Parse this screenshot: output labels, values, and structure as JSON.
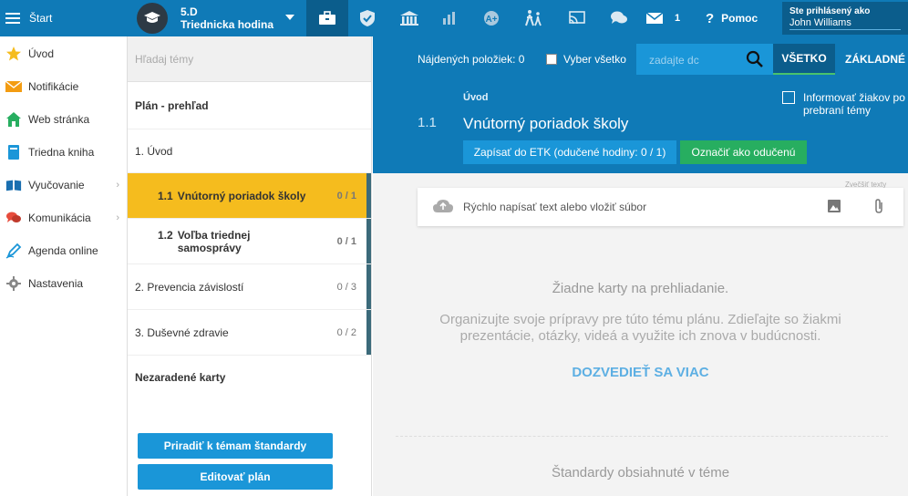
{
  "topbar": {
    "start_label": "Štart",
    "class_name": "5.D",
    "class_subtitle": "Triednicka hodina",
    "mail_count": "1",
    "help_label": "Pomoc",
    "logged_in_label": "Ste prihlásený ako",
    "user_name": "John Williams"
  },
  "sidebar": {
    "items": [
      {
        "label": "Úvod",
        "icon": "star-icon",
        "color": "#f5bc1e"
      },
      {
        "label": "Notifikácie",
        "icon": "envelope-icon",
        "color": "#f39c12"
      },
      {
        "label": "Web stránka",
        "icon": "home-icon",
        "color": "#27ae60"
      },
      {
        "label": "Triedna kniha",
        "icon": "book-icon",
        "color": "#1a96d8"
      },
      {
        "label": "Vyučovanie",
        "icon": "open-book-icon",
        "color": "#1a6fb0"
      },
      {
        "label": "Komunikácia",
        "icon": "chat-icon",
        "color": "#e74c3c"
      },
      {
        "label": "Agenda online",
        "icon": "pen-icon",
        "color": "#1a96d8"
      },
      {
        "label": "Nastavenia",
        "icon": "gear-icon",
        "color": "#888888"
      }
    ]
  },
  "topics": {
    "search_placeholder": "Hľadaj témy",
    "plan_overview": "Plán - prehľad",
    "section1": "1. Úvod",
    "t11_num": "1.1",
    "t11_label": "Vnútorný poriadok školy",
    "t11_count": "0 / 1",
    "t12_num": "1.2",
    "t12_label": "Voľba triednej samosprávy",
    "t12_count": "0 / 1",
    "section2": "2. Prevencia závislostí",
    "section2_count": "0 / 3",
    "section3": "3. Duševné zdravie",
    "section3_count": "0 / 2",
    "unsorted": "Nezaradené karty",
    "assign_button": "Priradiť k témam štandardy",
    "edit_button": "Editovať plán"
  },
  "main": {
    "found_label": "Nájdených položiek: 0",
    "select_all": "Vyber všetko",
    "search_placeholder": "zadajte dc",
    "tab_all": "VŠETKO",
    "tab_basic": "ZÁKLADNÉ",
    "breadcrumb": "Úvod",
    "topic_number": "1.1",
    "topic_title": "Vnútorný poriadok školy",
    "etk_button": "Zapísať do ETK (odučené hodiny: 0 / 1)",
    "mark_button": "Označiť ako odučenú",
    "inform_line1": "Informovať žiakov po",
    "inform_line2": "prebraní témy",
    "small_hint": "Zvečšiť texty",
    "quick_placeholder": "Rýchlo napísať text alebo vložiť súbor",
    "empty_title": "Žiadne karty na prehliadanie.",
    "empty_desc": "Organizujte svoje prípravy pre túto tému plánu. Zdieľajte so žiakmi prezentácie, otázky, videá a využite ich znova v budúcnosti.",
    "learn_more": "DOZVEDIEŤ SA VIAC",
    "standards_title": "Štandardy obsiahnuté v téme"
  },
  "colors": {
    "header_blue": "#0f7ab7",
    "active_topic": "#f5bc1e",
    "green_button": "#27ae60",
    "button_blue": "#1a96d8"
  }
}
